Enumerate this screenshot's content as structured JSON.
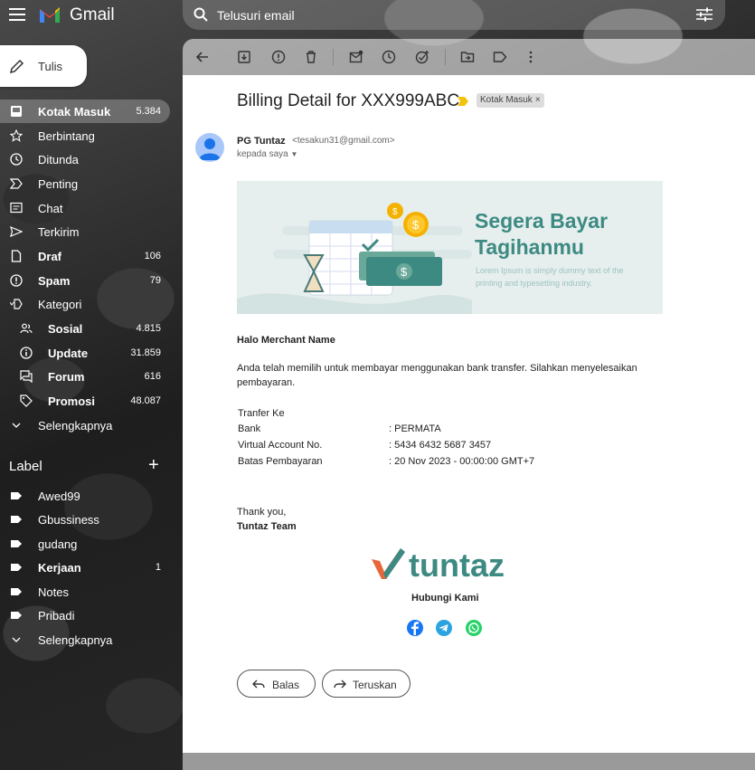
{
  "app": {
    "name": "Gmail"
  },
  "search": {
    "placeholder": "Telusuri email"
  },
  "compose": {
    "label": "Tulis"
  },
  "sidebar": {
    "items": [
      {
        "label": "Kotak Masuk",
        "count": "5.384",
        "icon": "inbox-icon"
      },
      {
        "label": "Berbintang",
        "count": "",
        "icon": "star-icon"
      },
      {
        "label": "Ditunda",
        "count": "",
        "icon": "clock-icon"
      },
      {
        "label": "Penting",
        "count": "",
        "icon": "important-icon"
      },
      {
        "label": "Chat",
        "count": "",
        "icon": "chat-icon"
      },
      {
        "label": "Terkirim",
        "count": "",
        "icon": "send-icon"
      },
      {
        "label": "Draf",
        "count": "106",
        "icon": "draft-icon"
      },
      {
        "label": "Spam",
        "count": "79",
        "icon": "spam-icon"
      },
      {
        "label": "Kategori",
        "count": "",
        "icon": "category-icon"
      }
    ],
    "categories": [
      {
        "label": "Sosial",
        "count": "4.815",
        "icon": "people-icon"
      },
      {
        "label": "Update",
        "count": "31.859",
        "icon": "info-icon"
      },
      {
        "label": "Forum",
        "count": "616",
        "icon": "forum-icon"
      },
      {
        "label": "Promosi",
        "count": "48.087",
        "icon": "tag-icon"
      }
    ],
    "more_label": "Selengkapnya",
    "labels_heading": "Label",
    "labels": [
      {
        "label": "Awed99",
        "count": ""
      },
      {
        "label": "Gbussiness",
        "count": ""
      },
      {
        "label": "gudang",
        "count": ""
      },
      {
        "label": "Kerjaan",
        "count": "1"
      },
      {
        "label": "Notes",
        "count": ""
      },
      {
        "label": "Pribadi",
        "count": ""
      }
    ],
    "labels_more": "Selengkapnya"
  },
  "email": {
    "subject": "Billing Detail for XXX999ABC",
    "chip": "Kotak Masuk",
    "chip_close": "×",
    "sender_name": "PG Tuntaz",
    "sender_email": "<tesakun31@gmail.com>",
    "to": "kepada saya",
    "banner": {
      "title_line1": "Segera Bayar",
      "title_line2": "Tagihanmu",
      "sub": "Lorem Ipsum is simply dummy text of the printing and typesetting industry."
    },
    "greeting": "Halo Merchant Name",
    "intro": "Anda telah memilih untuk membayar menggunakan bank transfer. Silahkan menyelesaikan pembayaran.",
    "transfer_heading": "Tranfer Ke",
    "details": [
      {
        "key": "Bank",
        "value": ":  PERMATA"
      },
      {
        "key": "Virtual Account No.",
        "value": ": 5434 6432 5687 3457"
      },
      {
        "key": "Batas Pembayaran",
        "value": ":  20 Nov 2023 - 00:00:00 GMT+7"
      }
    ],
    "thanks": "Thank you,",
    "team": "Tuntaz Team",
    "brand": "tuntaz",
    "contact": "Hubungi Kami",
    "reply": "Balas",
    "forward": "Teruskan"
  },
  "colors": {
    "accent": "#3d8a82",
    "chip_bg": "#dddddd",
    "facebook": "#1877f2",
    "telegram": "#2aa3e0",
    "whatsapp": "#25d366"
  }
}
